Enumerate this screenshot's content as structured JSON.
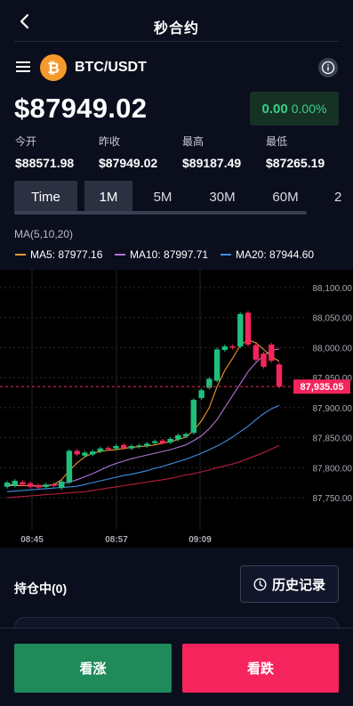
{
  "header": {
    "title": "秒合约"
  },
  "pair": {
    "name": "BTC/USDT",
    "coin_symbol": "₿"
  },
  "price": {
    "current": "$87949.02",
    "change_abs": "0.00",
    "change_pct": "0.00%"
  },
  "stats": [
    {
      "label": "今开",
      "value": "$88571.98"
    },
    {
      "label": "昨收",
      "value": "$87949.02"
    },
    {
      "label": "最高",
      "value": "$89187.49"
    },
    {
      "label": "最低",
      "value": "$87265.19"
    }
  ],
  "tabs": [
    "Time",
    "1M",
    "5M",
    "30M",
    "60M",
    "2"
  ],
  "indicators": {
    "title": "MA(5,10,20)",
    "items": [
      {
        "label": "MA5: 87977.16",
        "color": "#f0962e"
      },
      {
        "label": "MA10: 87997.71",
        "color": "#b274d6"
      },
      {
        "label": "MA20: 87944.60",
        "color": "#3f8fe0"
      }
    ]
  },
  "chart_data": {
    "type": "candlestick",
    "y_ticks": [
      "88,100.00",
      "88,050.00",
      "88,000.00",
      "87,950.00",
      "87,900.00",
      "87,850.00",
      "87,800.00",
      "87,750.00"
    ],
    "ylim": [
      87730,
      88110
    ],
    "x_ticks": [
      "08:45",
      "08:57",
      "09:09"
    ],
    "current_price_label": "87,935.05",
    "current_price": 87935.05,
    "candles": [
      {
        "o": 87768,
        "c": 87775
      },
      {
        "o": 87770,
        "c": 87778
      },
      {
        "o": 87776,
        "c": 87772
      },
      {
        "o": 87774,
        "c": 87768
      },
      {
        "o": 87771,
        "c": 87767
      },
      {
        "o": 87768,
        "c": 87772
      },
      {
        "o": 87772,
        "c": 87770
      },
      {
        "o": 87766,
        "c": 87777
      },
      {
        "o": 87775,
        "c": 87828
      },
      {
        "o": 87828,
        "c": 87822
      },
      {
        "o": 87820,
        "c": 87825
      },
      {
        "o": 87822,
        "c": 87827
      },
      {
        "o": 87827,
        "c": 87832
      },
      {
        "o": 87833,
        "c": 87831
      },
      {
        "o": 87832,
        "c": 87836
      },
      {
        "o": 87838,
        "c": 87833
      },
      {
        "o": 87832,
        "c": 87836
      },
      {
        "o": 87835,
        "c": 87837
      },
      {
        "o": 87836,
        "c": 87840
      },
      {
        "o": 87841,
        "c": 87844
      },
      {
        "o": 87845,
        "c": 87841
      },
      {
        "o": 87842,
        "c": 87848
      },
      {
        "o": 87847,
        "c": 87854
      },
      {
        "o": 87852,
        "c": 87856
      },
      {
        "o": 87858,
        "c": 87913
      },
      {
        "o": 87916,
        "c": 87929
      },
      {
        "o": 87933,
        "c": 87948
      },
      {
        "o": 87945,
        "c": 87997
      },
      {
        "o": 87996,
        "c": 88002
      },
      {
        "o": 88002,
        "c": 88000
      },
      {
        "o": 88002,
        "c": 88056
      },
      {
        "o": 88058,
        "c": 88005
      },
      {
        "o": 88004,
        "c": 87980
      },
      {
        "o": 87990,
        "c": 87968
      },
      {
        "o": 88005,
        "c": 87978
      },
      {
        "o": 87972,
        "c": 87935
      }
    ],
    "ma5": [
      87772,
      87771,
      87770,
      87770,
      87769,
      87770,
      87772,
      87780,
      87795,
      87808,
      87818,
      87824,
      87827,
      87829,
      87830,
      87832,
      87834,
      87835,
      87836,
      87838,
      87841,
      87843,
      87847,
      87851,
      87862,
      87878,
      87900,
      87935,
      87962,
      87982,
      88004,
      88013,
      88008,
      87997,
      87985,
      87977
    ],
    "ma10": [
      87770,
      87770,
      87770,
      87770,
      87770,
      87770,
      87771,
      87773,
      87776,
      87780,
      87785,
      87790,
      87796,
      87802,
      87807,
      87811,
      87815,
      87818,
      87821,
      87824,
      87827,
      87830,
      87834,
      87838,
      87845,
      87853,
      87865,
      87880,
      87900,
      87920,
      87940,
      87960,
      87975,
      87987,
      87995,
      87998
    ],
    "ma20": [
      87760,
      87761,
      87762,
      87763,
      87764,
      87765,
      87766,
      87767,
      87768,
      87769,
      87772,
      87775,
      87778,
      87781,
      87784,
      87787,
      87789,
      87792,
      87795,
      87799,
      87802,
      87806,
      87810,
      87814,
      87819,
      87824,
      87830,
      87836,
      87843,
      87851,
      87860,
      87869,
      87880,
      87890,
      87898,
      87904
    ],
    "ma_long": [
      87750,
      87751,
      87752,
      87753,
      87754,
      87755,
      87756,
      87757,
      87758,
      87759,
      87760,
      87762,
      87764,
      87766,
      87768,
      87770,
      87772,
      87774,
      87776,
      87778,
      87780,
      87782,
      87785,
      87788,
      87790,
      87793,
      87796,
      87800,
      87803,
      87806,
      87810,
      87815,
      87820,
      87825,
      87831,
      87837
    ],
    "colors": {
      "up": "#1fbf7c",
      "down": "#f5245c",
      "ma5": "#f0962e",
      "ma10": "#b274d6",
      "ma20": "#3f8fe0",
      "ma_long": "#b8203f"
    }
  },
  "position": {
    "label": "持仓中(0)",
    "history_label": "历史记录"
  },
  "actions": {
    "buy_label": "看涨",
    "sell_label": "看跌"
  }
}
